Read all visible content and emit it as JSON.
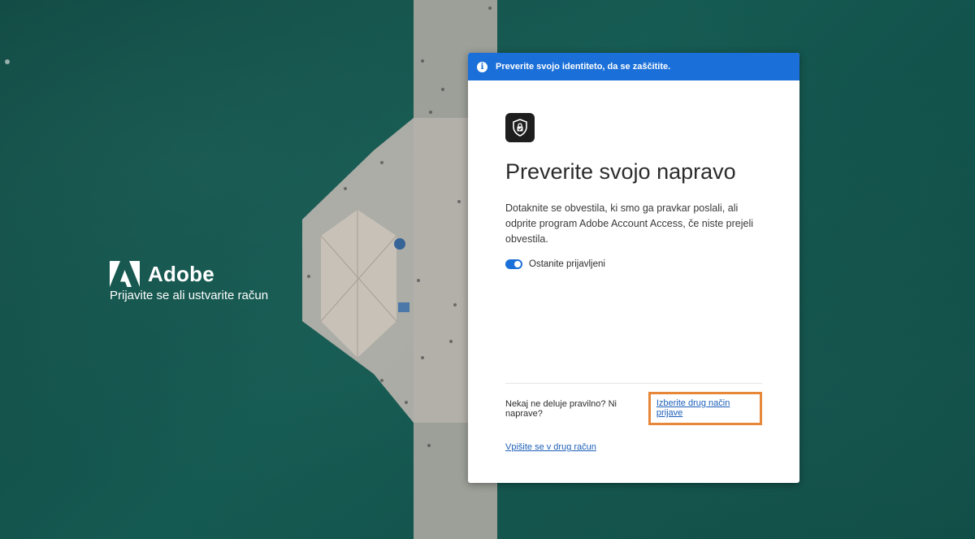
{
  "brand": {
    "name": "Adobe",
    "tagline": "Prijavite se ali ustvarite račun"
  },
  "banner": {
    "text": "Preverite svojo identiteto, da se zaščitite."
  },
  "card": {
    "title": "Preverite svojo napravo",
    "description": "Dotaknite se obvestila, ki smo ga pravkar poslali, ali odprite program Adobe Account Access, če niste prejeli obvestila.",
    "stay_signed_in": "Ostanite prijavljeni",
    "help_text": "Nekaj ne deluje pravilno? Ni naprave?",
    "alt_method_link": "Izberite drug način prijave",
    "other_account_link": "Vpišite se v drug račun"
  },
  "icons": {
    "banner": "info-icon",
    "app": "shield-lock-icon",
    "logo": "adobe-logo-icon"
  },
  "colors": {
    "banner": "#1a6fd8",
    "highlight": "#e7873a",
    "link": "#1c5fb8"
  }
}
